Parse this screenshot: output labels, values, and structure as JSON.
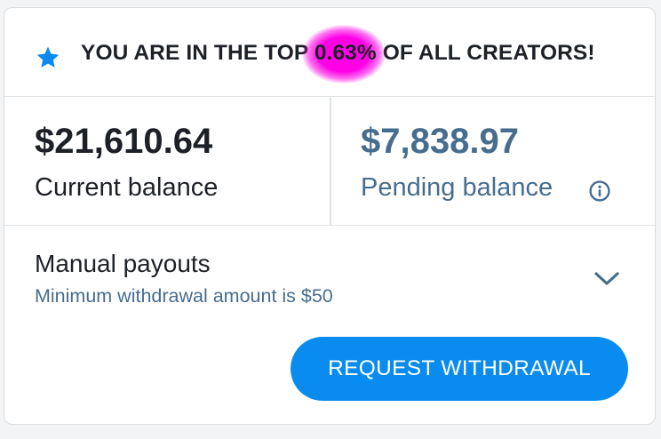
{
  "banner": {
    "icon": "star-icon",
    "text_before": "YOU ARE IN THE TOP ",
    "rank_percent": "0.63%",
    "text_after": " OF ALL CREATORS!",
    "highlight_color": "#ff00e6",
    "icon_color": "#0a8bf0"
  },
  "balances": {
    "current": {
      "amount": "$21,610.64",
      "label": "Current balance"
    },
    "pending": {
      "amount": "$7,838.97",
      "label": "Pending balance",
      "icon": "info-icon",
      "color": "#476d8e"
    }
  },
  "payouts": {
    "title": "Manual payouts",
    "subtitle": "Minimum withdrawal amount is $50",
    "toggle_icon": "chevron-down-icon"
  },
  "actions": {
    "withdraw_label": "REQUEST WITHDRAWAL",
    "accent": "#0a8bf0"
  }
}
